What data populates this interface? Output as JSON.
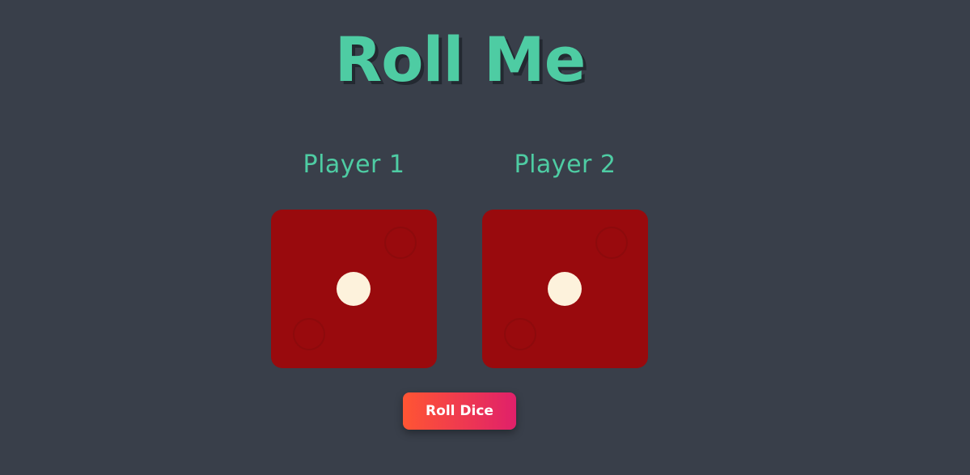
{
  "title": "Roll Me",
  "players": [
    {
      "label": "Player 1",
      "die_value": 1
    },
    {
      "label": "Player 2",
      "die_value": 1
    }
  ],
  "roll_button_label": "Roll Dice",
  "colors": {
    "background": "#393f4a",
    "accent": "#4ecca3",
    "die": "#990a0d",
    "pip": "#fdf2dc",
    "button_gradient_start": "#ff5533",
    "button_gradient_end": "#e0206a"
  }
}
